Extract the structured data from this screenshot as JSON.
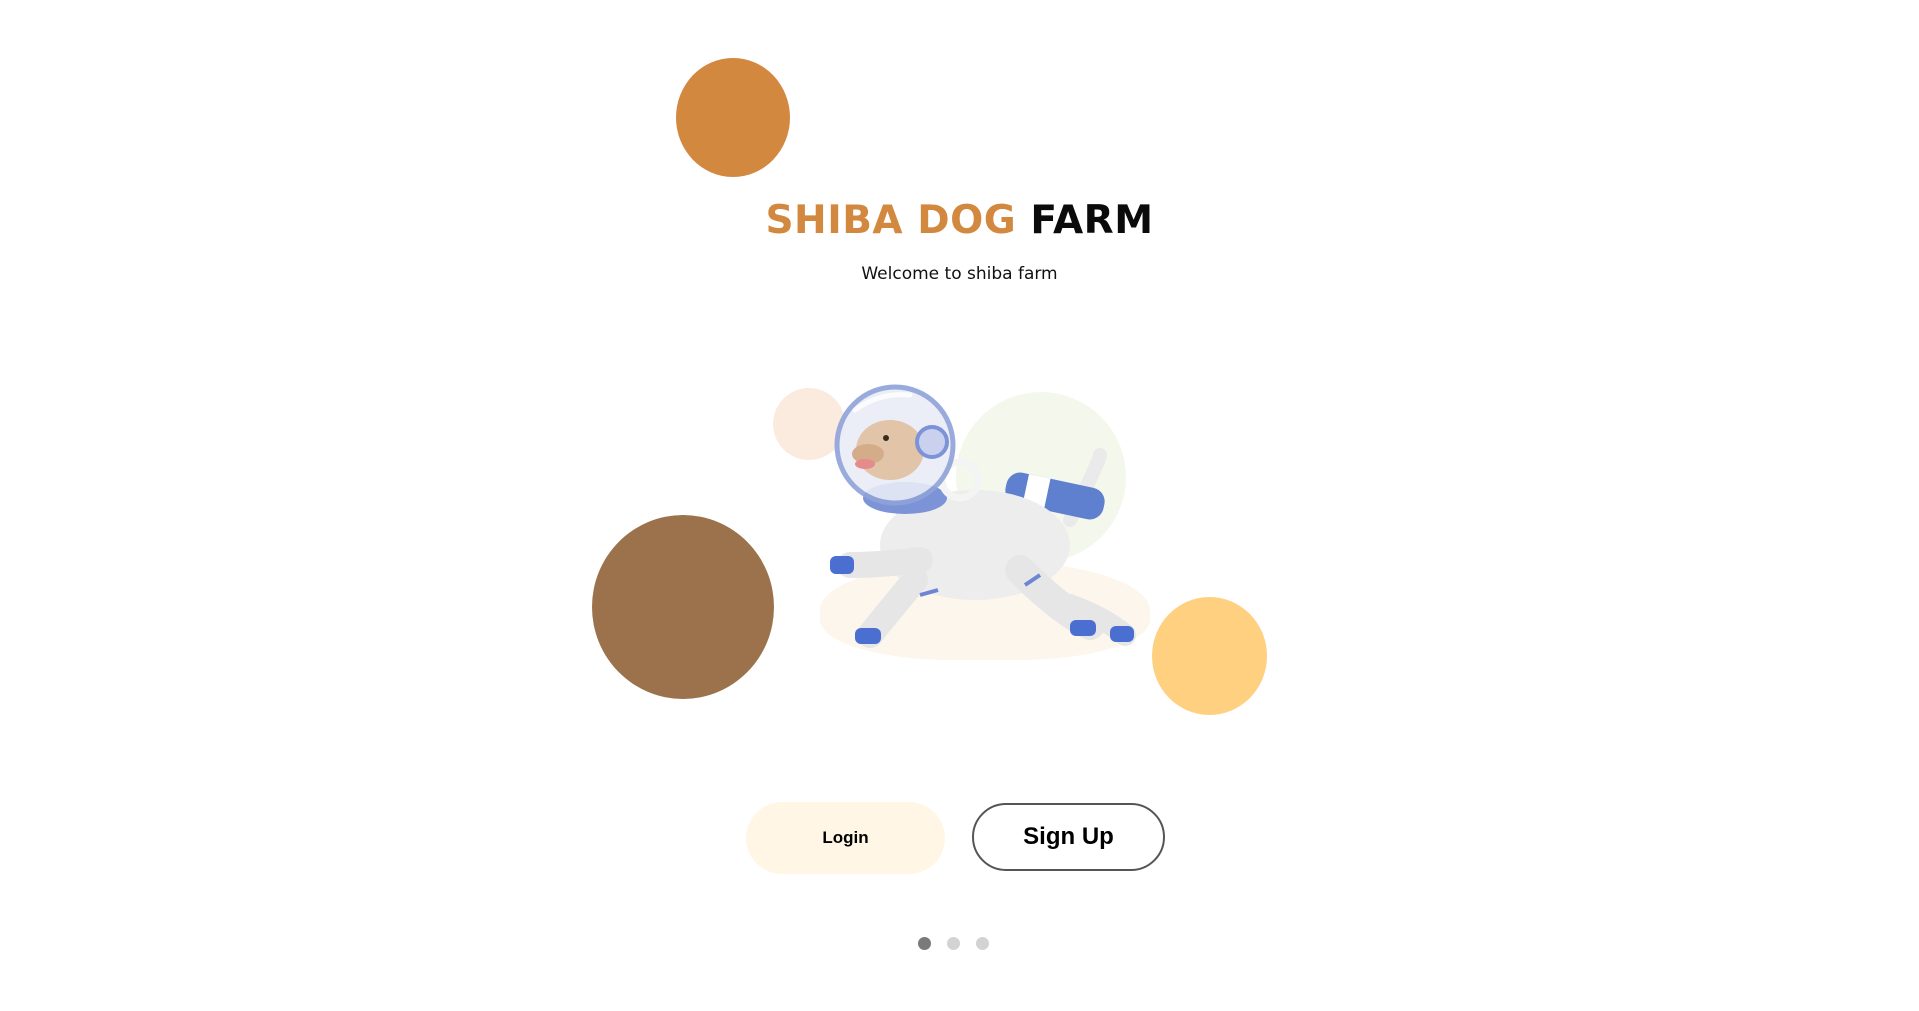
{
  "header": {
    "brand_accent": "SHIBA DOG",
    "brand_rest": "FARM",
    "subtitle": "Welcome to shiba farm"
  },
  "hero": {
    "icon": "astronaut-dog-illustration"
  },
  "actions": {
    "login_label": "Login",
    "signup_label": "Sign Up"
  },
  "pagination": {
    "total": 3,
    "active_index": 0
  },
  "colors": {
    "accent_orange": "#D3883F",
    "brown": "#9B724B",
    "yellow": "#FFD080",
    "login_bg": "#FFF6E5",
    "peach_blob": "#F8D9C2",
    "green_blob": "#ECF2DF",
    "ground_blob": "#FCEEDD",
    "title_black": "#0B0B0B"
  }
}
